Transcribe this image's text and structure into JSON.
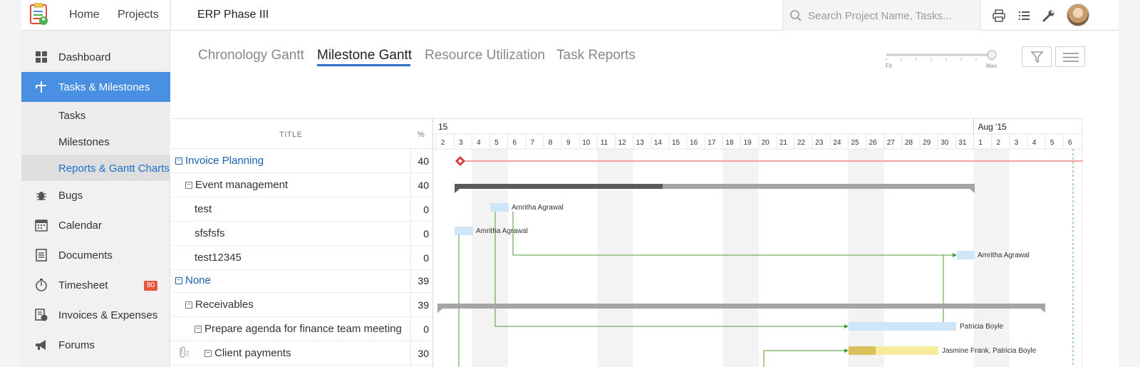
{
  "nav": {
    "home": "Home",
    "projects": "Projects",
    "project_title": "ERP Phase III",
    "search_placeholder": "Search Project Name, Tasks..."
  },
  "sidebar": {
    "items": [
      {
        "label": "Dashboard",
        "icon": "dashboard-icon"
      },
      {
        "label": "Tasks & Milestones",
        "icon": "tasks-icon"
      },
      {
        "label": "Bugs",
        "icon": "bug-icon"
      },
      {
        "label": "Calendar",
        "icon": "calendar-icon"
      },
      {
        "label": "Documents",
        "icon": "document-icon"
      },
      {
        "label": "Timesheet",
        "icon": "timer-icon",
        "badge": "80"
      },
      {
        "label": "Invoices & Expenses",
        "icon": "invoice-icon"
      },
      {
        "label": "Forums",
        "icon": "megaphone-icon"
      }
    ],
    "sub_items": [
      "Tasks",
      "Milestones",
      "Reports & Gantt Charts"
    ]
  },
  "tabs": [
    "Chronology Gantt",
    "Milestone Gantt",
    "Resource Utilization",
    "Task Reports"
  ],
  "zoom": {
    "min_label": "Fit",
    "max_label": "Max"
  },
  "grid": {
    "title_header": "TITLE",
    "pct_header": "%",
    "rows": [
      {
        "title": "Invoice Planning",
        "pct": "40"
      },
      {
        "title": "Event management",
        "pct": "40"
      },
      {
        "title": "test",
        "pct": "0"
      },
      {
        "title": "sfsfsfs",
        "pct": "0"
      },
      {
        "title": "test12345",
        "pct": "0"
      },
      {
        "title": "None",
        "pct": "39"
      },
      {
        "title": "Receivables",
        "pct": "39"
      },
      {
        "title": "Prepare agenda for finance team meeting",
        "pct": "0"
      },
      {
        "title": "Client payments",
        "pct": "30"
      }
    ]
  },
  "timeline": {
    "month_labels": [
      "15",
      "Aug '15"
    ],
    "days": [
      "2",
      "3",
      "4",
      "5",
      "6",
      "7",
      "8",
      "9",
      "10",
      "11",
      "12",
      "13",
      "14",
      "15",
      "16",
      "17",
      "18",
      "19",
      "20",
      "21",
      "22",
      "23",
      "24",
      "25",
      "26",
      "27",
      "28",
      "29",
      "30",
      "31",
      "1",
      "2",
      "3",
      "4",
      "5",
      "6"
    ],
    "assignees": [
      "Amritha Agrawal",
      "Amritha Agrawal",
      "Amritha Agrawal",
      "Patricia Boyle",
      "Jasmine Frank, Patricia Boyle"
    ],
    "colors": {
      "milestone_line": "#f4a0a0",
      "milestone_marker": "#d63b3b",
      "task_bar": "#cfe5f8",
      "dependency": "#4c9a3b",
      "progress_bar": "#dcc15a",
      "progress_bar_rest": "#f7ec9b",
      "today_line": "#4caf50"
    }
  }
}
